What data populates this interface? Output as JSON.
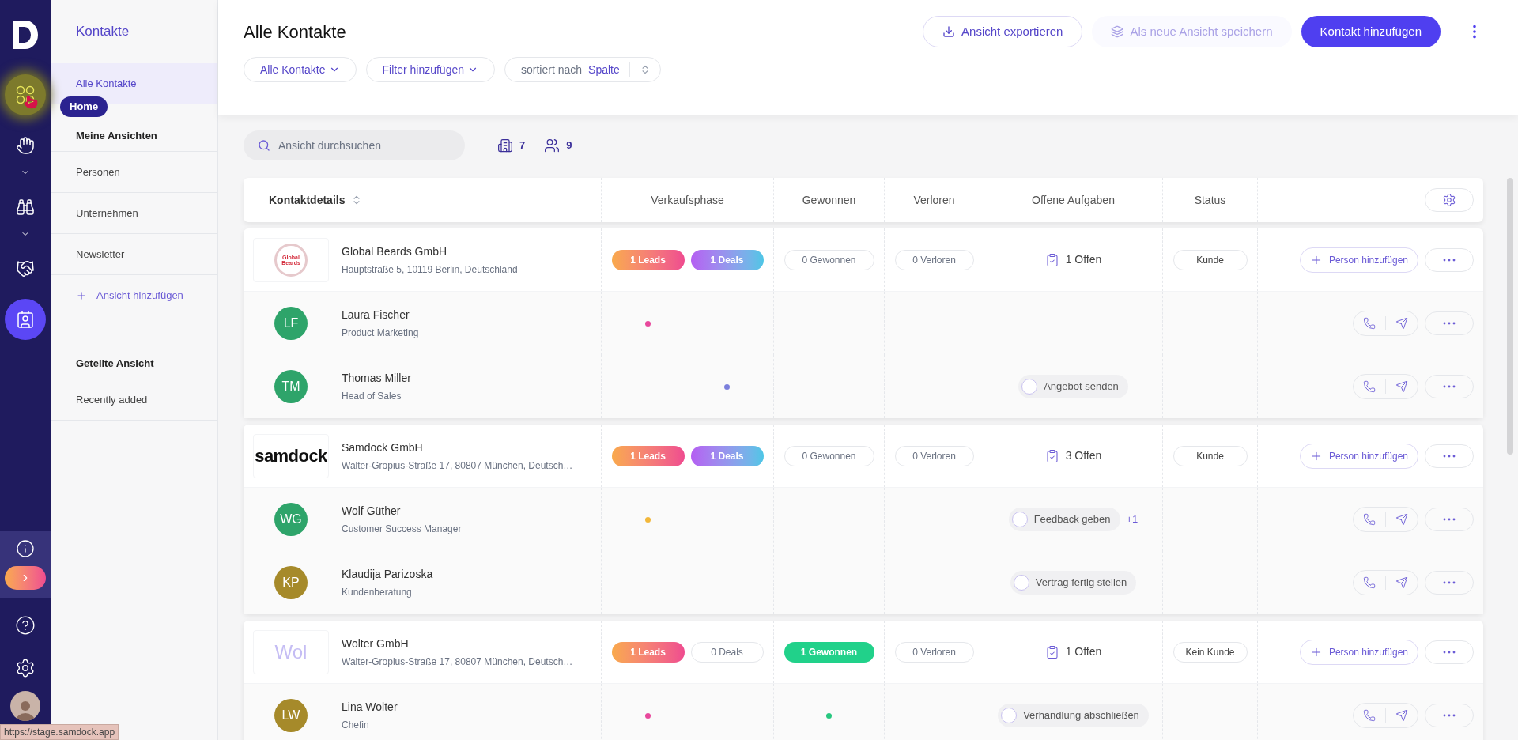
{
  "rail": {
    "items": [
      {
        "kind": "home",
        "selected": false,
        "highlighted": true,
        "expandable": false
      },
      {
        "kind": "tasks",
        "selected": false,
        "highlighted": false,
        "expandable": true
      },
      {
        "kind": "explore",
        "selected": false,
        "highlighted": false,
        "expandable": true
      },
      {
        "kind": "deals",
        "selected": false,
        "highlighted": false,
        "expandable": false
      },
      {
        "kind": "contacts",
        "selected": true,
        "highlighted": false,
        "expandable": false
      }
    ],
    "tooltip": "Home"
  },
  "sidebar": {
    "title": "Kontakte",
    "items": [
      {
        "label": "Alle Kontakte",
        "selected": true
      }
    ],
    "sections": [
      {
        "heading": "Meine Ansichten",
        "items": [
          {
            "label": "Personen",
            "selected": false
          },
          {
            "label": "Unternehmen",
            "selected": false
          },
          {
            "label": "Newsletter",
            "selected": false
          }
        ],
        "add": "Ansicht hinzufügen"
      },
      {
        "heading": "Geteilte Ansicht",
        "items": [
          {
            "label": "Recently added",
            "selected": false
          }
        ]
      }
    ]
  },
  "status_url": "https://stage.samdock.app",
  "header": {
    "title": "Alle Kontakte",
    "actions": [
      {
        "kind": "outline",
        "label": "Ansicht exportieren",
        "disabled": false
      },
      {
        "kind": "ghost",
        "label": "Als neue Ansicht speichern",
        "disabled": true
      },
      {
        "kind": "primary",
        "label": "Kontakt hinzufügen",
        "disabled": false
      }
    ],
    "filters": [
      {
        "label": "Alle Kontakte"
      },
      {
        "label": "Filter hinzufügen"
      }
    ],
    "sort": {
      "prefix": "sortiert nach",
      "value": "Spalte"
    }
  },
  "toolbar": {
    "search": {
      "placeholder": "Ansicht durchsuchen"
    },
    "counts": [
      {
        "kind": "companies",
        "value": "7"
      },
      {
        "kind": "people",
        "value": "9"
      }
    ]
  },
  "table": {
    "columns": [
      {
        "label": "Kontaktdetails",
        "sortable": true
      },
      {
        "label": "Verkaufsphase",
        "sortable": false
      },
      {
        "label": "Gewonnen",
        "sortable": false
      },
      {
        "label": "Verloren",
        "sortable": false
      },
      {
        "label": "Offene Aufgaben",
        "sortable": false
      },
      {
        "label": "Status",
        "sortable": false
      }
    ],
    "groups": [
      {
        "company": {
          "logo": {
            "kind": "seal",
            "text": "Global Beards"
          },
          "name": "Global Beards GmbH",
          "address": "Hauptstraße 5, 10119 Berlin, Deutschland",
          "leads": {
            "label": "1 Leads",
            "active": true
          },
          "deals": {
            "label": "1 Deals",
            "active": true
          },
          "won": {
            "label": "0 Gewonnen",
            "active": false
          },
          "lost": {
            "label": "0 Verloren",
            "active": false
          },
          "tasks": "1 Offen",
          "status": "Kunde",
          "add_label": "Person hinzufügen"
        },
        "persons": [
          {
            "initials": "LF",
            "color": "#2ea46a",
            "name": "Laura Fischer",
            "role": "Product Marketing",
            "stage_dots": {
              "leads": {
                "color": "#e8489c"
              }
            }
          },
          {
            "initials": "TM",
            "color": "#2ea46a",
            "name": "Thomas Miller",
            "role": "Head of Sales",
            "stage_dots": {
              "deals": {
                "color": "#7b7fdc"
              }
            },
            "task": {
              "label": "Angebot senden",
              "checked": false
            }
          }
        ]
      },
      {
        "company": {
          "logo": {
            "kind": "wordmark",
            "text": "samdock"
          },
          "name": "Samdock GmbH",
          "address": "Walter-Gropius-Straße 17, 80807 München, Deutsch…",
          "leads": {
            "label": "1 Leads",
            "active": true
          },
          "deals": {
            "label": "1 Deals",
            "active": true
          },
          "won": {
            "label": "0 Gewonnen",
            "active": false
          },
          "lost": {
            "label": "0 Verloren",
            "active": false
          },
          "tasks": "3 Offen",
          "status": "Kunde",
          "add_label": "Person hinzufügen"
        },
        "persons": [
          {
            "initials": "WG",
            "color": "#2ea46a",
            "name": "Wolf Güther",
            "role": "Customer Success Manager",
            "stage_dots": {
              "leads": {
                "color": "#f2b73a"
              }
            },
            "task": {
              "label": "Feedback geben",
              "checked": false
            },
            "extra": "+1"
          },
          {
            "initials": "KP",
            "color": "#a68a2a",
            "name": "Klaudija Parizoska",
            "role": "Kundenberatung",
            "task": {
              "label": "Vertrag fertig stellen",
              "checked": false
            }
          }
        ]
      },
      {
        "company": {
          "logo": {
            "kind": "faded",
            "text": "Wol"
          },
          "name": "Wolter GmbH",
          "address": "Walter-Gropius-Straße 17, 80807 München, Deutsch…",
          "leads": {
            "label": "1 Leads",
            "active": true
          },
          "deals": {
            "label": "0 Deals",
            "active": false
          },
          "won": {
            "label": "1 Gewonnen",
            "active": true
          },
          "lost": {
            "label": "0 Verloren",
            "active": false
          },
          "tasks": "1 Offen",
          "status": "Kein Kunde",
          "add_label": "Person hinzufügen"
        },
        "persons": [
          {
            "initials": "LW",
            "color": "#a68a2a",
            "name": "Lina Wolter",
            "role": "Chefin",
            "stage_dots": {
              "leads": {
                "color": "#e8489c"
              },
              "won": {
                "color": "#27c77f"
              }
            },
            "task": {
              "label": "Verhandlung abschließen",
              "checked": false
            }
          }
        ]
      }
    ]
  }
}
